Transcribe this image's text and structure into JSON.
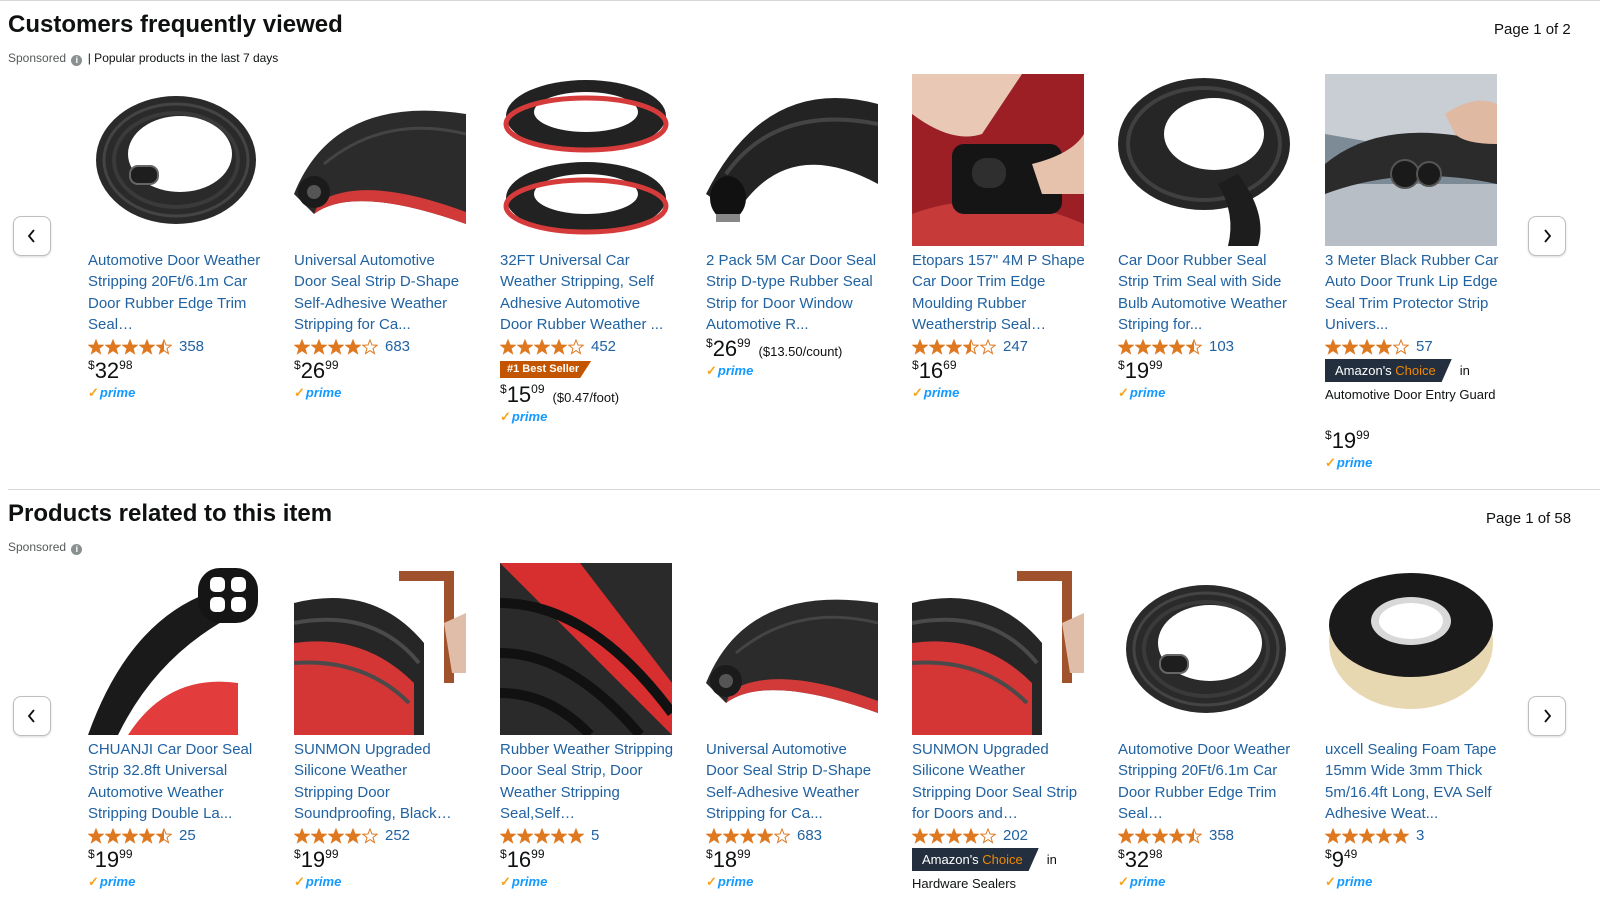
{
  "sections": [
    {
      "title": "Customers frequently viewed",
      "page_indicator": "Page 1 of 2",
      "sponsored": "Sponsored",
      "subtitle": "| Popular products in the last 7 days",
      "prev_button": "previous-page",
      "next_button": "next-page",
      "products": [
        {
          "title": "Automotive Door Weather Stripping 20Ft/6.1m Car Door Rubber Edge Trim Seal…",
          "stars": 4.5,
          "reviews": "358",
          "price_sym": "$",
          "price_whole": "32",
          "price_frac": "98",
          "unit": "",
          "prime": "prime",
          "badge": "",
          "choice": "",
          "choice_in": "",
          "choice_cat": "",
          "image": "coil-bulb-seal"
        },
        {
          "title": "Universal Automotive Door Seal Strip D-Shape Self-Adhesive Weather Stripping for Ca...",
          "stars": 4,
          "reviews": "683",
          "price_sym": "$",
          "price_whole": "26",
          "price_frac": "99",
          "unit": "",
          "prime": "prime",
          "badge": "",
          "choice": "",
          "choice_in": "",
          "choice_cat": "",
          "image": "d-shape-seal"
        },
        {
          "title": "32FT Universal Car Weather Stripping, Self Adhesive Automotive Door Rubber Weather ...",
          "stars": 4,
          "reviews": "452",
          "price_sym": "$",
          "price_whole": "15",
          "price_frac": "09",
          "unit": "($0.47/foot)",
          "prime": "prime",
          "badge": "#1 Best Seller",
          "choice": "",
          "choice_in": "",
          "choice_cat": "",
          "image": "two-coils-red"
        },
        {
          "title": "2 Pack 5M Car Door Seal Strip D-type Rubber Seal Strip for Door Window Automotive R...",
          "stars": 0,
          "reviews": "",
          "price_sym": "$",
          "price_whole": "26",
          "price_frac": "99",
          "unit": "($13.50/count)",
          "prime": "prime",
          "badge": "",
          "choice": "",
          "choice_in": "",
          "choice_cat": "",
          "image": "d-type-seal"
        },
        {
          "title": "Etopars 157\" 4M P Shape Car Door Trim Edge Moulding Rubber Weatherstrip Seal…",
          "stars": 3.5,
          "reviews": "247",
          "price_sym": "$",
          "price_whole": "16",
          "price_frac": "69",
          "unit": "",
          "prime": "prime",
          "badge": "",
          "choice": "",
          "choice_in": "",
          "choice_cat": "",
          "image": "p-shape-hand"
        },
        {
          "title": "Car Door Rubber Seal Strip Trim Seal with Side Bulb Automotive Weather Striping for...",
          "stars": 4.5,
          "reviews": "103",
          "price_sym": "$",
          "price_whole": "19",
          "price_frac": "99",
          "unit": "",
          "prime": "prime",
          "badge": "",
          "choice": "",
          "choice_in": "",
          "choice_cat": "",
          "image": "side-bulb-seal"
        },
        {
          "title": "3 Meter Black Rubber Car Auto Door Trunk Lip Edge Seal Trim Protector Strip Univers...",
          "stars": 4,
          "reviews": "57",
          "price_sym": "$",
          "price_whole": "19",
          "price_frac": "99",
          "unit": "",
          "prime": "prime",
          "badge": "",
          "choice": "Amazon's Choice",
          "choice_in": "in",
          "choice_cat": "Automotive Door Entry Guard",
          "image": "trunk-lip-seal"
        }
      ]
    },
    {
      "title": "Products related to this item",
      "page_indicator": "Page 1 of 58",
      "sponsored": "Sponsored",
      "subtitle": "",
      "prev_button": "previous-page",
      "next_button": "next-page",
      "products": [
        {
          "title": "CHUANJI Car Door Seal Strip 32.8ft Universal Automotive Weather Stripping Double La...",
          "stars": 4.5,
          "reviews": "25",
          "price_sym": "$",
          "price_whole": "19",
          "price_frac": "99",
          "unit": "",
          "prime": "prime",
          "badge": "",
          "choice": "",
          "choice_in": "",
          "choice_cat": "",
          "image": "double-layer-seal"
        },
        {
          "title": "SUNMON Upgraded Silicone Weather Stripping Door Soundproofing, Black…",
          "stars": 4,
          "reviews": "252",
          "price_sym": "$",
          "price_whole": "19",
          "price_frac": "99",
          "unit": "",
          "prime": "prime",
          "badge": "",
          "choice": "",
          "choice_in": "",
          "choice_cat": "",
          "image": "sunmon-door"
        },
        {
          "title": "Rubber Weather Stripping Door Seal Strip, Door Weather Stripping Seal,Self…",
          "stars": 5,
          "reviews": "5",
          "price_sym": "$",
          "price_whole": "16",
          "price_frac": "99",
          "unit": "",
          "prime": "prime",
          "badge": "",
          "choice": "",
          "choice_in": "",
          "choice_cat": "",
          "image": "red-coil-closeup"
        },
        {
          "title": "Universal Automotive Door Seal Strip D-Shape Self-Adhesive Weather Stripping for Ca...",
          "stars": 4,
          "reviews": "683",
          "price_sym": "$",
          "price_whole": "18",
          "price_frac": "99",
          "unit": "",
          "prime": "prime",
          "badge": "",
          "choice": "",
          "choice_in": "",
          "choice_cat": "",
          "image": "d-shape-seal"
        },
        {
          "title": "SUNMON Upgraded Silicone Weather Stripping Door Seal Strip for Doors and…",
          "stars": 4,
          "reviews": "202",
          "price_sym": "",
          "price_whole": "",
          "price_frac": "",
          "unit": "",
          "prime": "",
          "badge": "",
          "choice": "Amazon's Choice",
          "choice_in": "in",
          "choice_cat": "Hardware Sealers",
          "image": "sunmon-door"
        },
        {
          "title": "Automotive Door Weather Stripping 20Ft/6.1m Car Door Rubber Edge Trim Seal…",
          "stars": 4.5,
          "reviews": "358",
          "price_sym": "$",
          "price_whole": "32",
          "price_frac": "98",
          "unit": "",
          "prime": "prime",
          "badge": "",
          "choice": "",
          "choice_in": "",
          "choice_cat": "",
          "image": "coil-bulb-seal"
        },
        {
          "title": "uxcell Sealing Foam Tape 15mm Wide 3mm Thick 5m/16.4ft Long, EVA Self Adhesive Weat...",
          "stars": 5,
          "reviews": "3",
          "price_sym": "$",
          "price_whole": "9",
          "price_frac": "49",
          "unit": "",
          "prime": "prime",
          "badge": "",
          "choice": "",
          "choice_in": "",
          "choice_cat": "",
          "image": "foam-tape-roll"
        }
      ]
    }
  ],
  "colors": {
    "link": "#2162a1",
    "star": "#de7921",
    "prime": "#1399ff",
    "best_seller": "#c45500",
    "choice": "#232f3e"
  }
}
